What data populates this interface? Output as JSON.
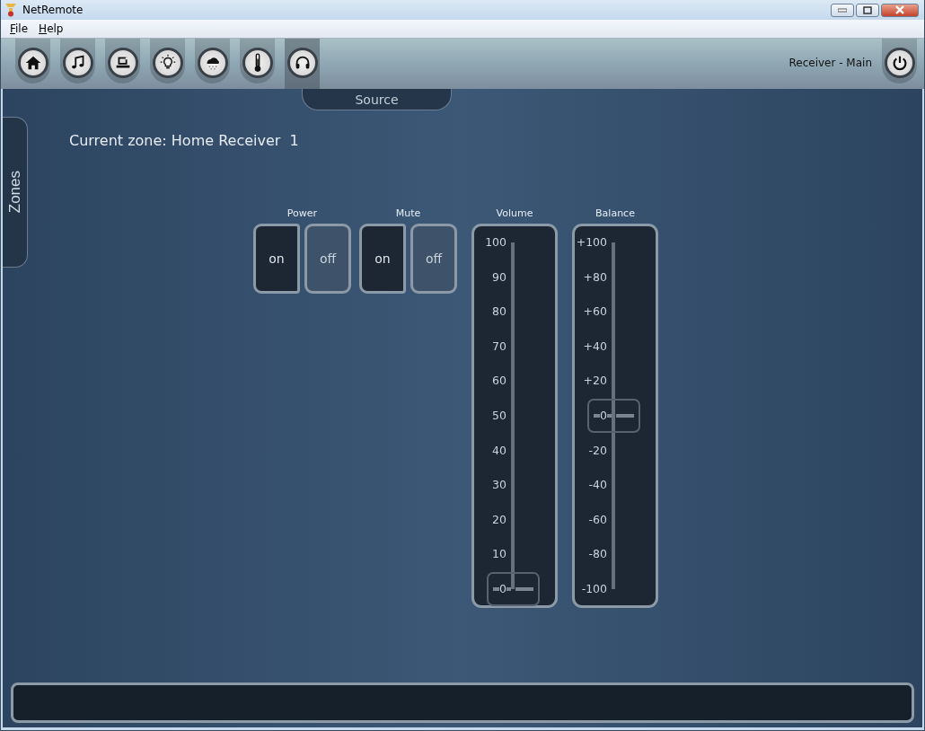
{
  "window": {
    "title": "NetRemote"
  },
  "menu": [
    "File",
    "Help"
  ],
  "toolbar": {
    "items": [
      {
        "kind": "home",
        "selected": false
      },
      {
        "kind": "music",
        "selected": false
      },
      {
        "kind": "computer",
        "selected": false
      },
      {
        "kind": "bulb",
        "selected": false
      },
      {
        "kind": "weather",
        "selected": false
      },
      {
        "kind": "thermometer",
        "selected": false
      },
      {
        "kind": "headphones",
        "selected": true
      }
    ],
    "device": "Receiver - Main"
  },
  "section_tab": "Source",
  "side_tab": "Zones",
  "current_zone": "Current zone: Home Receiver  1",
  "toggles": [
    {
      "label": "Power",
      "options": [
        {
          "label": "on",
          "selected": true
        },
        {
          "label": "off",
          "selected": false
        }
      ]
    },
    {
      "label": "Mute",
      "options": [
        {
          "label": "on",
          "selected": true
        },
        {
          "label": "off",
          "selected": false
        }
      ]
    }
  ],
  "sliders": [
    {
      "label": "Volume",
      "level": 0,
      "ticks": [
        "100",
        "90",
        "80",
        "70",
        "60",
        "50",
        "40",
        "30",
        "20",
        "10",
        "0"
      ]
    },
    {
      "label": "Balance",
      "level": 0.5,
      "ticks": [
        "+100",
        "+80",
        "+60",
        "+40",
        "+20",
        "0",
        "-20",
        "-40",
        "-60",
        "-80",
        "-100"
      ]
    }
  ]
}
